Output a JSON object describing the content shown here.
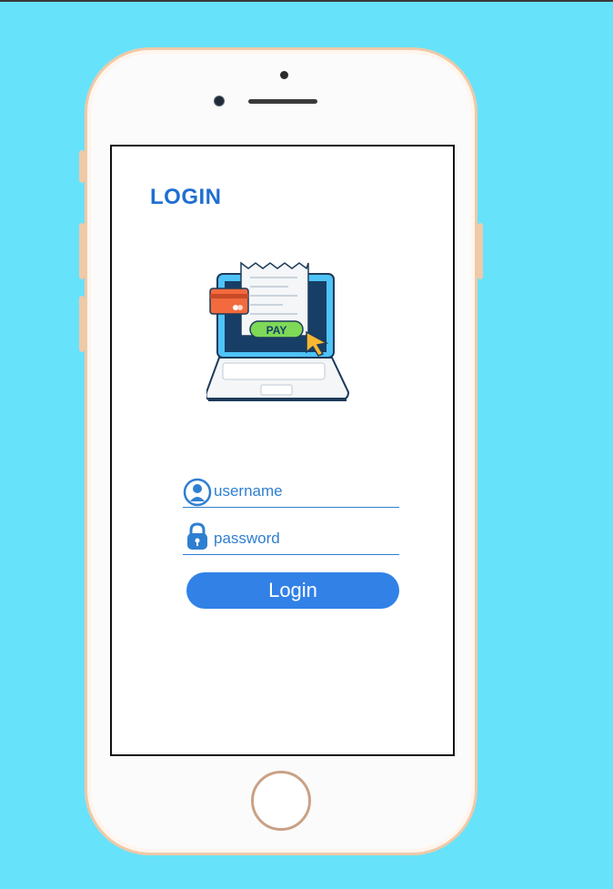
{
  "screen": {
    "title": "LOGIN",
    "illustration": {
      "name": "laptop-payment-illustration",
      "pay_label": "PAY"
    },
    "form": {
      "username": {
        "placeholder": "username",
        "value": "",
        "icon": "user-icon"
      },
      "password": {
        "placeholder": "password",
        "value": "",
        "icon": "lock-icon"
      },
      "submit_label": "Login"
    }
  },
  "colors": {
    "background": "#67e2fb",
    "accent": "#1f6fd1",
    "button": "#3181e7"
  }
}
